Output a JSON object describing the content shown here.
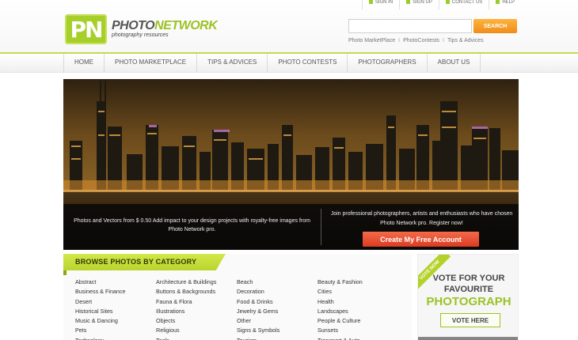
{
  "topbar": {
    "links": [
      {
        "label": "Sign in"
      },
      {
        "label": "Sign up"
      },
      {
        "label": "Contact us"
      },
      {
        "label": "Help"
      }
    ]
  },
  "logo": {
    "badge": "PN",
    "title_a": "PHOTO",
    "title_b": "NETWORK",
    "subtitle": "photography resources"
  },
  "search": {
    "value": "",
    "button": "Search",
    "links": [
      "Photo MarketPlace",
      "PhotoContests",
      "Tips & Advices"
    ],
    "separator": "I"
  },
  "nav": {
    "items": [
      "Home",
      "Photo Marketplace",
      "Tips & Advices",
      "Photo Contests",
      "Photographers",
      "About us"
    ]
  },
  "hero": {
    "left_text": "Photos and Vectors from $ 0.50 Add impact to your design projects with royalty-free images from Photo Network pro.",
    "right_text": "Join professional photographers, artists and enthusiasts who have chosen Photo Network pro. Register now!",
    "cta": "Create My Free Account"
  },
  "browse": {
    "title": "Browse Photos by Category",
    "columns": [
      [
        "Abstract",
        "Business & Finance",
        "Desert",
        "Historical Sites",
        "Music & Dancing",
        "Pets",
        "Technology"
      ],
      [
        "Architecture & Buildings",
        "Buttons & Backgrounds",
        "Fauna & Flora",
        "Illustrations",
        "Objects",
        "Religious",
        "Tools"
      ],
      [
        "Beach",
        "Decoration",
        "Food & Drinks",
        "Jewelry & Gems",
        "Other",
        "Signs & Symbols",
        "Tourism"
      ],
      [
        "Beauty & Fashion",
        "Cities",
        "Health",
        "Landscapes",
        "People & Culture",
        "Sunsets",
        "Transport & Auto"
      ]
    ]
  },
  "vote": {
    "ribbon": "Vote Now",
    "line1": "VOTE FOR YOUR",
    "line2": "FAVOURITE",
    "line3": "PHOTOGRAPH",
    "button": "Vote Here"
  },
  "colors": {
    "accent": "#a7cf2a",
    "search_button": "#f5a12a",
    "cta": "#e2472a"
  }
}
